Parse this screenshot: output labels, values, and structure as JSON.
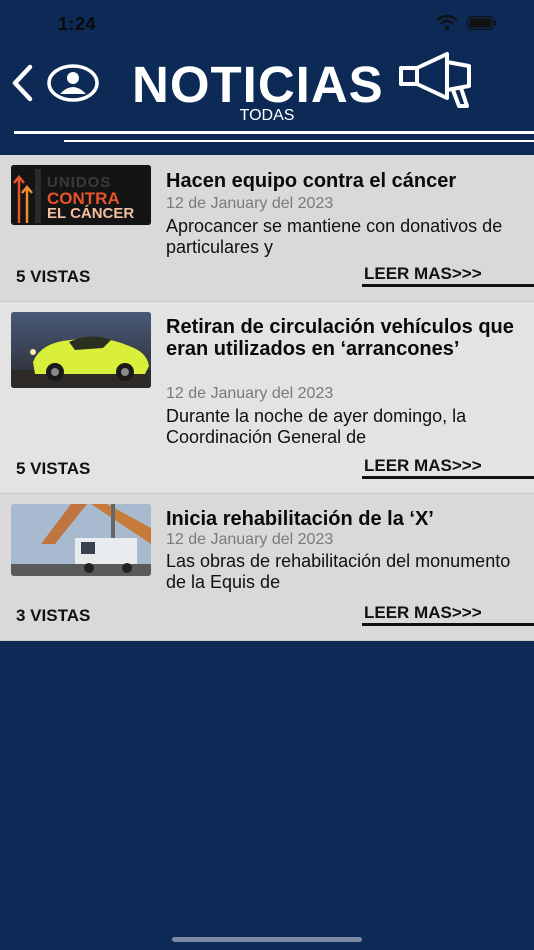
{
  "status_bar": {
    "time": "1:24"
  },
  "header": {
    "title": "NOTICIAS",
    "subtitle": "TODAS"
  },
  "articles": [
    {
      "title": "Hacen equipo contra el cáncer",
      "date": "12 de January del 2023",
      "excerpt": "Aprocancer se mantiene con donativos de particulares y",
      "views": "5 VISTAS",
      "read_more": "LEER MAS>>>",
      "thumbnail": {
        "line1": "UNIDOS",
        "line2": "CONTRA",
        "line3": "EL CÁNCER"
      }
    },
    {
      "title": "Retiran de circulación vehículos que eran utilizados en ‘arrancones’",
      "date": "12 de January del 2023",
      "excerpt": "Durante la noche de ayer domingo, la Coordinación General de",
      "views": "5 VISTAS",
      "read_more": "LEER MAS>>>"
    },
    {
      "title": "Inicia rehabilitación de la ‘X’",
      "date": "12 de January del 2023",
      "excerpt": "Las obras de rehabilitación del monumento de la Equis de",
      "views": "3 VISTAS",
      "read_more": "LEER MAS>>>"
    }
  ],
  "colors": {
    "background": "#0c2a55",
    "card_light": "#e3e3e3",
    "card_dark": "#d9d9d9"
  },
  "icons": [
    "back-chevron-icon",
    "user-icon",
    "megaphone-icon",
    "wifi-icon",
    "battery-icon"
  ]
}
